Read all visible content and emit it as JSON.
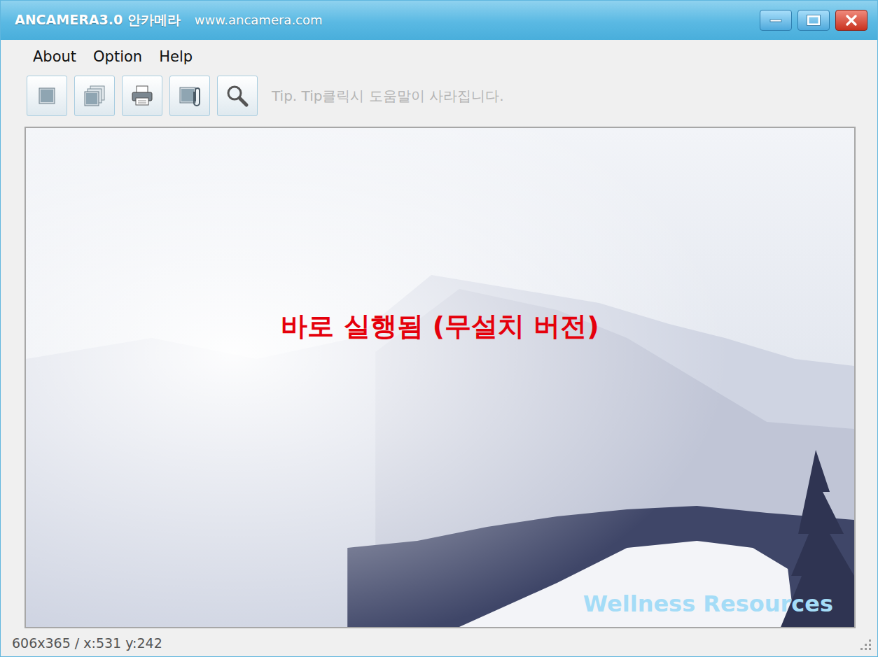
{
  "window": {
    "title": "ANCAMERA3.0 안카메라",
    "url": "www.ancamera.com"
  },
  "menu": [
    "About",
    "Option",
    "Help"
  ],
  "toolbar": {
    "tip": "Tip. Tip클릭시 도움말이 사라집니다."
  },
  "overlays": {
    "caption": "바로 실행됨 (무설치 버전)",
    "watermark": "Wellness Resources"
  },
  "status_bar": {
    "text": "606x365 / x:531 y:242"
  }
}
